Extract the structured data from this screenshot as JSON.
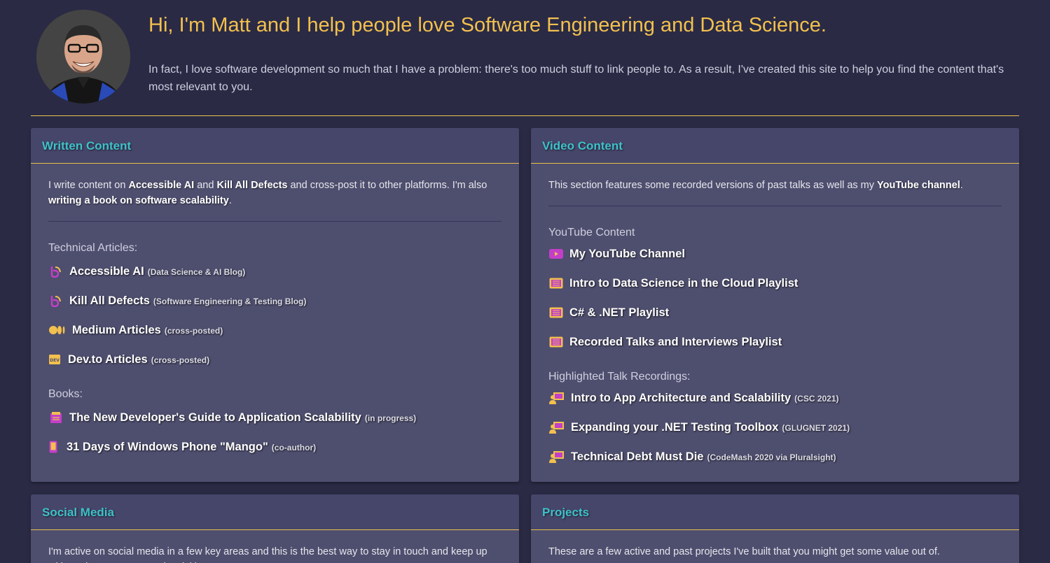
{
  "header": {
    "headline": "Hi, I'm Matt and I help people love Software Engineering and Data Science.",
    "intro": "In fact, I love software development so much that I have a problem: there's too much stuff to link people to. As a result, I've created this site to help you find the content that's most relevant to you."
  },
  "written": {
    "title": "Written Content",
    "desc_parts": [
      "I write content on ",
      "Accessible AI",
      " and ",
      "Kill All Defects",
      " and cross-post it to other platforms. I'm also ",
      "writing a book on software scalability",
      "."
    ],
    "articles_label": "Technical Articles:",
    "articles": [
      {
        "label": "Accessible AI",
        "note": "(Data Science & AI Blog)",
        "icon": "blog-icon"
      },
      {
        "label": "Kill All Defects",
        "note": "(Software Engineering & Testing Blog)",
        "icon": "blog-icon"
      },
      {
        "label": "Medium Articles",
        "note": "(cross-posted)",
        "icon": "medium-icon"
      },
      {
        "label": "Dev.to Articles",
        "note": "(cross-posted)",
        "icon": "devto-icon"
      }
    ],
    "books_label": "Books:",
    "books": [
      {
        "label": "The New Developer's Guide to Application Scalability",
        "note": "(in progress)",
        "icon": "book-icon"
      },
      {
        "label": "31 Days of Windows Phone \"Mango\"",
        "note": "(co-author)",
        "icon": "phone-icon"
      }
    ]
  },
  "video": {
    "title": "Video Content",
    "desc_parts": [
      "This section features some recorded versions of past talks as well as my ",
      "YouTube channel",
      "."
    ],
    "youtube_label": "YouTube Content",
    "youtube": [
      {
        "label": "My YouTube Channel",
        "icon": "youtube-icon"
      },
      {
        "label": "Intro to Data Science in the Cloud Playlist",
        "icon": "playlist-icon"
      },
      {
        "label": "C# & .NET Playlist",
        "icon": "playlist-icon"
      },
      {
        "label": "Recorded Talks and Interviews Playlist",
        "icon": "playlist-icon"
      }
    ],
    "talks_label": "Highlighted Talk Recordings:",
    "talks": [
      {
        "label": "Intro to App Architecture and Scalability",
        "note": "(CSC 2021)",
        "icon": "presenter-icon"
      },
      {
        "label": "Expanding your .NET Testing Toolbox",
        "note": "(GLUGNET 2021)",
        "icon": "presenter-icon"
      },
      {
        "label": "Technical Debt Must Die",
        "note": "(CodeMash 2020 via Pluralsight)",
        "icon": "presenter-icon"
      }
    ]
  },
  "social": {
    "title": "Social Media",
    "desc": "I'm active on social media in a few key areas and this is the best way to stay in touch and keep up with my latest content and activities."
  },
  "projects": {
    "title": "Projects",
    "desc": "These are a few active and past projects I've built that you might get some value out of."
  },
  "colors": {
    "background": "#2a2a45",
    "card": "#4e4e6e",
    "accent_gold": "#f2c04e",
    "title_teal": "#3fc1c9",
    "icon_magenta": "#c33fc9"
  }
}
